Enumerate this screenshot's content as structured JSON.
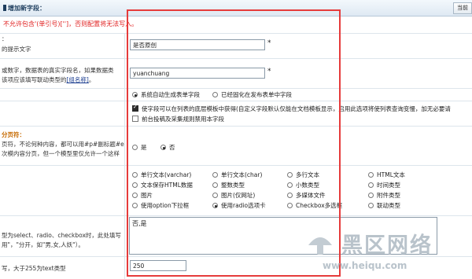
{
  "header": {
    "title": "增加新字段：",
    "top_button": "当前"
  },
  "warning": "不允许包含'(单引号)['']，否则配置将无法写入。",
  "rows": {
    "prompt": {
      "label": "的提示文字",
      "value": "是否原创",
      "required": "*"
    },
    "field_name": {
      "label_1": "或数字，数据表的真实字段名，如果数据类",
      "label_2": "该项应该填写联动类型的",
      "label_link": "[组名称]",
      "label_end": "。",
      "value": "yuanchuang",
      "required": "*"
    },
    "form_mode": {
      "options": [
        "系统自动生成表单字段",
        "已经固化在发布表单中字段"
      ],
      "selected": 0
    },
    "search": {
      "opt1": "使字段可以在列表的底层模板中获得(自定义字段默认仅能在文档模板显示，启用此选项将使列表查询变慢，加无必要请",
      "opt2": "前台投稿及采集规则禁用本字段"
    },
    "paging": {
      "label_title": "分页符：",
      "label_1": "页符，不论何种内容，都可以用#p#副标题#e",
      "label_2": "次模内容分页，但一个模型里仅允许一个这样",
      "yes": "是",
      "no": "否",
      "selected": "no"
    },
    "data_type": {
      "options": [
        "单行文本(varchar)",
        "单行文本(char)",
        "多行文本",
        "HTML文本",
        "文本保存HTML数据",
        "整数类型",
        "小数类型",
        "时间类型",
        "图片",
        "图片(仅网址)",
        "多媒体文件",
        "附件类型",
        "使用option下拉框",
        "使用radio选项卡",
        "Checkbox多选框",
        "联动类型"
      ],
      "selected_index": 13
    },
    "default_value": {
      "label_1": "型为select、radio、checkbox时，此处填写",
      "label_2": "用\"，\"分开，如\"男,女,人妖\"）。",
      "value": "否,是"
    },
    "max_length": {
      "label": "写，大于255为text类型",
      "value": "250"
    }
  },
  "watermark": {
    "name": "黑区网络",
    "url": "www.heiqu.com"
  }
}
